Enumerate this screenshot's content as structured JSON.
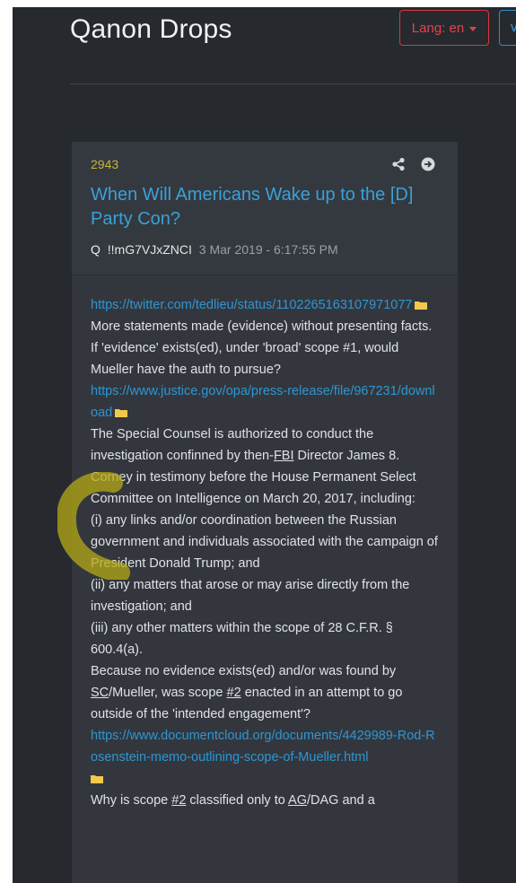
{
  "header": {
    "site_title": "Qanon Drops",
    "lang_button": "Lang: en",
    "extra_button": "v"
  },
  "post": {
    "number": "2943",
    "title": "When Will Americans Wake up to the [D] Party Con?",
    "author": "Q",
    "tripcode": "!!mG7VJxZNCI",
    "timestamp": "3 Mar 2019 - 6:17:55 PM",
    "link1": "https://twitter.com/tedlieu/status/1102265163107971077",
    "p1": "More statements made (evidence) without presenting facts.",
    "p2": "If 'evidence' exists(ed), under 'broad' scope #1, would Mueller have the auth to pursue?",
    "link2": "https://www.justice.gov/opa/press-release/file/967231/download",
    "p3a": "The Special Counsel is authorized to conduct the investigation confinned by then-",
    "p3_fbi": "FBI",
    "p3b": " Director James 8. Corney in testimony before the House Permanent Select Committee on Intelligence on March 20, 2017, including:",
    "p4": "(i) any links and/or coordination between the Russian government and individuals associated with the campaign of President Donald Trump; and",
    "p5": "(ii) any matters that arose or may arise directly from the investigation; and",
    "p6": "(iii) any other matters within the scope of 28 C.F.R. § 600.4(a).",
    "p7a": "Because no evidence exists(ed) and/or was found by ",
    "p7_sc": "SC",
    "p7b": "/Mueller, was scope ",
    "p7_num": "#2",
    "p7c": " enacted in an attempt to go outside of the 'intended engagement'?",
    "link3": "https://www.documentcloud.org/documents/4429989-Rod-Rosenstein-memo-outlining-scope-of-Mueller.html",
    "p8a": "Why is scope ",
    "p8_num": "#2",
    "p8b": " classified only to ",
    "p8_ag": "AG",
    "p8c": "/DAG and a"
  },
  "colors": {
    "background": "#262a2f",
    "card": "#33373d",
    "title_blue": "#3aa0d9",
    "number_yellow": "#c9b53b",
    "link_blue": "#2f95d1",
    "lang_red": "#e0434b",
    "highlight": "#b5a916"
  },
  "icons": [
    "share-icon",
    "arrow-circle-right-icon",
    "folder-icon"
  ]
}
